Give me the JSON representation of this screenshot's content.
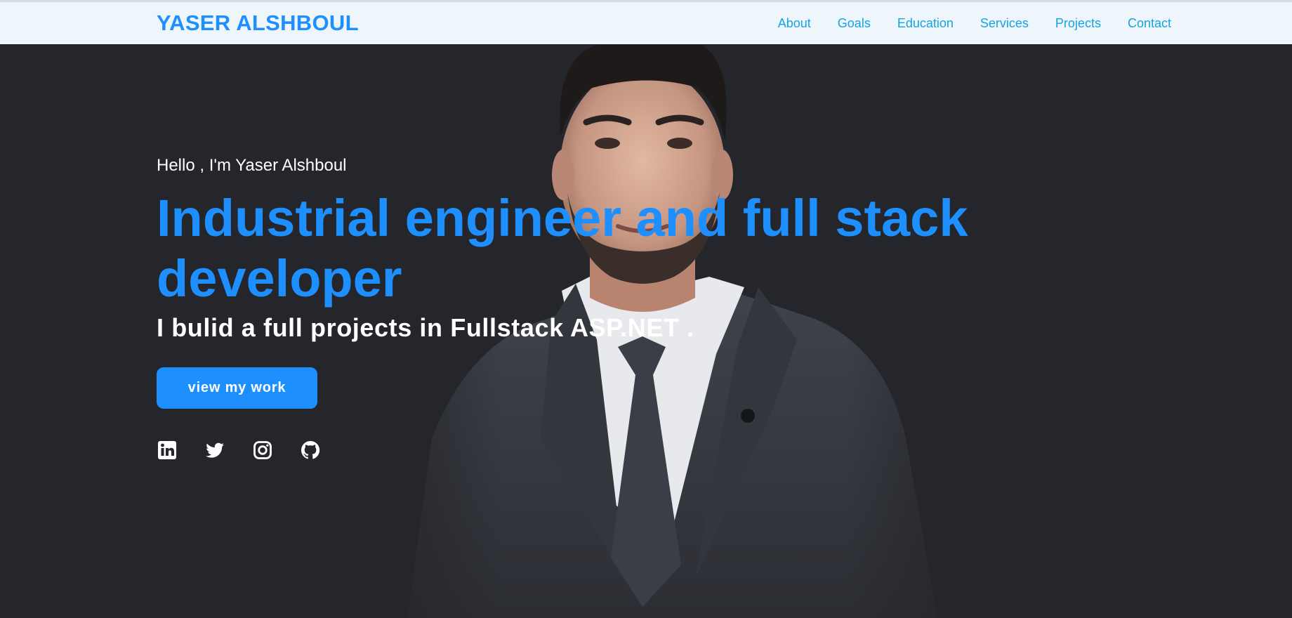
{
  "brand": {
    "name": "YASER ALSHBOUL",
    "color": "#1e8fff"
  },
  "nav": {
    "links": [
      {
        "label": "About"
      },
      {
        "label": "Goals"
      },
      {
        "label": "Education"
      },
      {
        "label": "Services"
      },
      {
        "label": "Projects"
      },
      {
        "label": "Contact"
      }
    ],
    "link_color": "#14a4e3",
    "background": "#eef6fc"
  },
  "hero": {
    "greeting": "Hello , I'm Yaser Alshboul",
    "headline": "Industrial engineer and full stack developer",
    "subline": "I bulid a full projects in Fullstack ASP.NET .",
    "cta_label": "view my work",
    "background": "#25262b",
    "accent": "#1e8fff",
    "image": "portrait-photo"
  },
  "socials": [
    {
      "icon": "linkedin-icon"
    },
    {
      "icon": "twitter-icon"
    },
    {
      "icon": "instagram-icon"
    },
    {
      "icon": "github-icon"
    }
  ]
}
